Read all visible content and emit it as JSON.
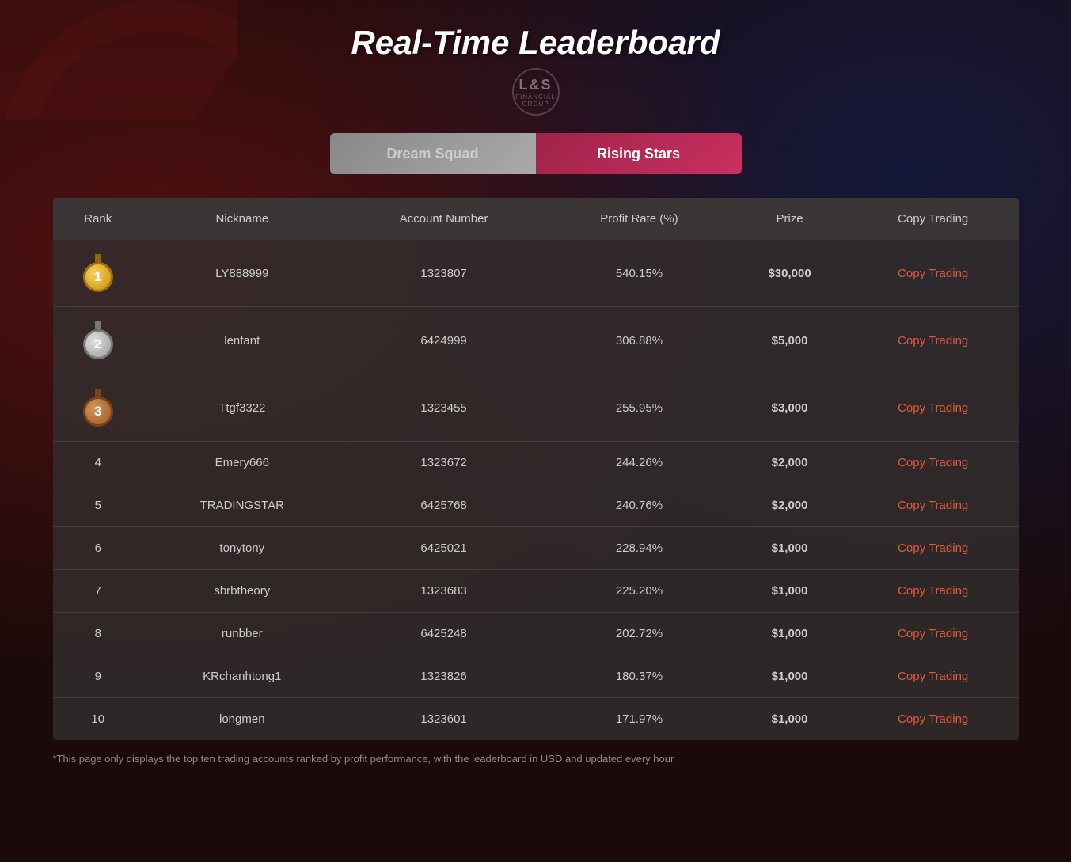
{
  "page": {
    "title": "Real-Time Leaderboard",
    "logo_main": "L&S",
    "logo_sub": "FINANCIAL GROUP",
    "footer_note": "*This page only displays the top ten trading accounts ranked by profit performance, with the leaderboard in USD and updated every hour"
  },
  "tabs": [
    {
      "id": "dream-squad",
      "label": "Dream Squad",
      "active": false
    },
    {
      "id": "rising-stars",
      "label": "Rising Stars",
      "active": true
    }
  ],
  "table": {
    "headers": [
      "Rank",
      "Nickname",
      "Account Number",
      "Profit Rate (%)",
      "Prize",
      "Copy Trading"
    ],
    "rows": [
      {
        "rank": "1",
        "medal": "gold",
        "nickname": "LY888999",
        "account": "1323807",
        "profit_rate": "540.15%",
        "prize": "$30,000",
        "copy_trading": "Copy Trading"
      },
      {
        "rank": "2",
        "medal": "silver",
        "nickname": "lenfant",
        "account": "6424999",
        "profit_rate": "306.88%",
        "prize": "$5,000",
        "copy_trading": "Copy Trading"
      },
      {
        "rank": "3",
        "medal": "bronze",
        "nickname": "Ttgf3322",
        "account": "1323455",
        "profit_rate": "255.95%",
        "prize": "$3,000",
        "copy_trading": "Copy Trading"
      },
      {
        "rank": "4",
        "medal": null,
        "nickname": "Emery666",
        "account": "1323672",
        "profit_rate": "244.26%",
        "prize": "$2,000",
        "copy_trading": "Copy Trading"
      },
      {
        "rank": "5",
        "medal": null,
        "nickname": "TRADINGSTAR",
        "account": "6425768",
        "profit_rate": "240.76%",
        "prize": "$2,000",
        "copy_trading": "Copy Trading"
      },
      {
        "rank": "6",
        "medal": null,
        "nickname": "tonytony",
        "account": "6425021",
        "profit_rate": "228.94%",
        "prize": "$1,000",
        "copy_trading": "Copy Trading"
      },
      {
        "rank": "7",
        "medal": null,
        "nickname": "sbrbtheory",
        "account": "1323683",
        "profit_rate": "225.20%",
        "prize": "$1,000",
        "copy_trading": "Copy Trading"
      },
      {
        "rank": "8",
        "medal": null,
        "nickname": "runbber",
        "account": "6425248",
        "profit_rate": "202.72%",
        "prize": "$1,000",
        "copy_trading": "Copy Trading"
      },
      {
        "rank": "9",
        "medal": null,
        "nickname": "KRchanhtong1",
        "account": "1323826",
        "profit_rate": "180.37%",
        "prize": "$1,000",
        "copy_trading": "Copy Trading"
      },
      {
        "rank": "10",
        "medal": null,
        "nickname": "longmen",
        "account": "1323601",
        "profit_rate": "171.97%",
        "prize": "$1,000",
        "copy_trading": "Copy Trading"
      }
    ]
  }
}
